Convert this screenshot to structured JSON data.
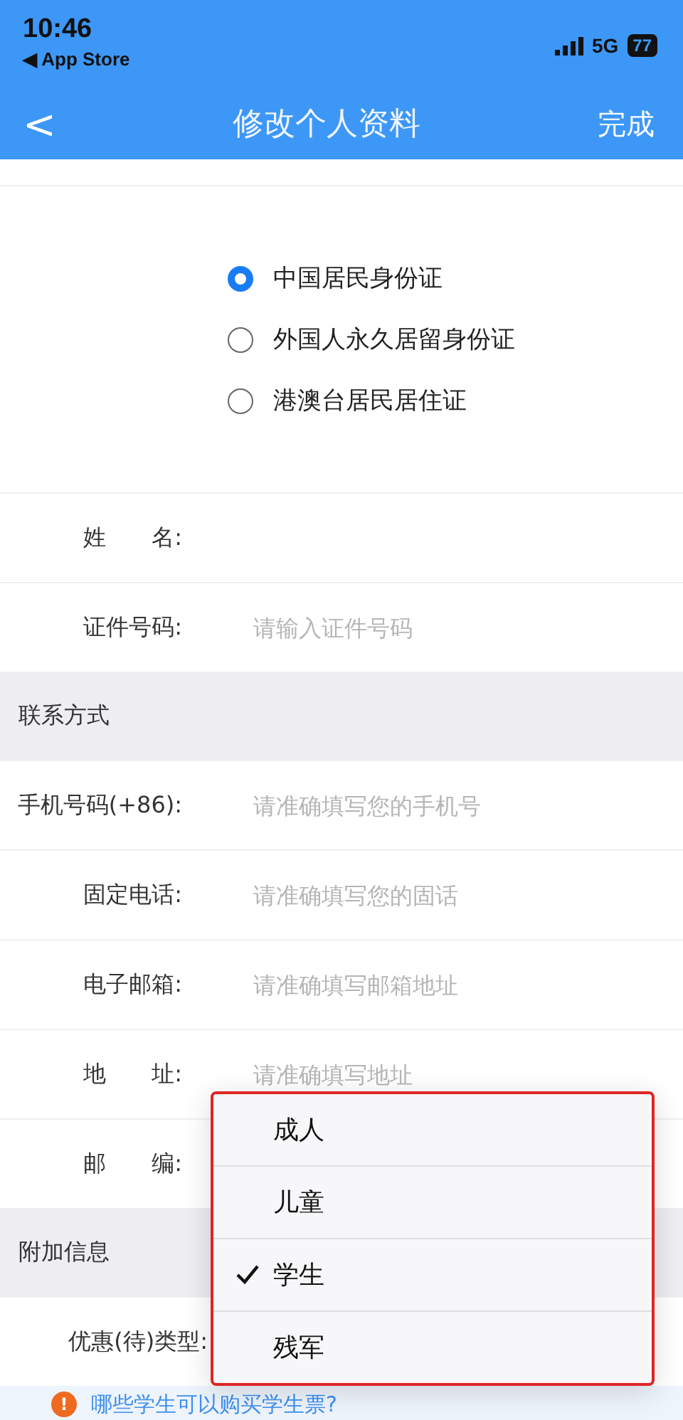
{
  "status_bar": {
    "time": "10:46",
    "back_app": "◀ App Store",
    "network": "5G",
    "battery": "77"
  },
  "nav": {
    "back": "<",
    "title": "修改个人资料",
    "action": "完成"
  },
  "id_types": [
    {
      "label": "中国居民身份证",
      "selected": true
    },
    {
      "label": "外国人永久居留身份证",
      "selected": false
    },
    {
      "label": "港澳台居民居住证",
      "selected": false
    }
  ],
  "identity_fields": [
    {
      "label": "姓　　名:"
    },
    {
      "label": "证件号码:",
      "placeholder": "请输入证件号码"
    }
  ],
  "contact_section": {
    "title": "联系方式",
    "fields": [
      {
        "label": "手机号码(+86):",
        "placeholder": "请准确填写您的手机号"
      },
      {
        "label": "固定电话:",
        "placeholder": "请准确填写您的固话"
      },
      {
        "label": "电子邮箱:",
        "placeholder": "请准确填写邮箱地址"
      },
      {
        "label": "地　　址:",
        "placeholder": "请准确填写地址"
      },
      {
        "label": "邮　　编:"
      }
    ]
  },
  "extra_section": {
    "title": "附加信息",
    "fields": [
      {
        "label": "优惠(待)类型:"
      }
    ]
  },
  "note": {
    "icon": "!",
    "text": "哪些学生可以购买学生票?"
  },
  "menu": {
    "items": [
      {
        "label": "成人",
        "selected": false
      },
      {
        "label": "儿童",
        "selected": false
      },
      {
        "label": "学生",
        "selected": true
      },
      {
        "label": "残军",
        "selected": false
      }
    ]
  }
}
